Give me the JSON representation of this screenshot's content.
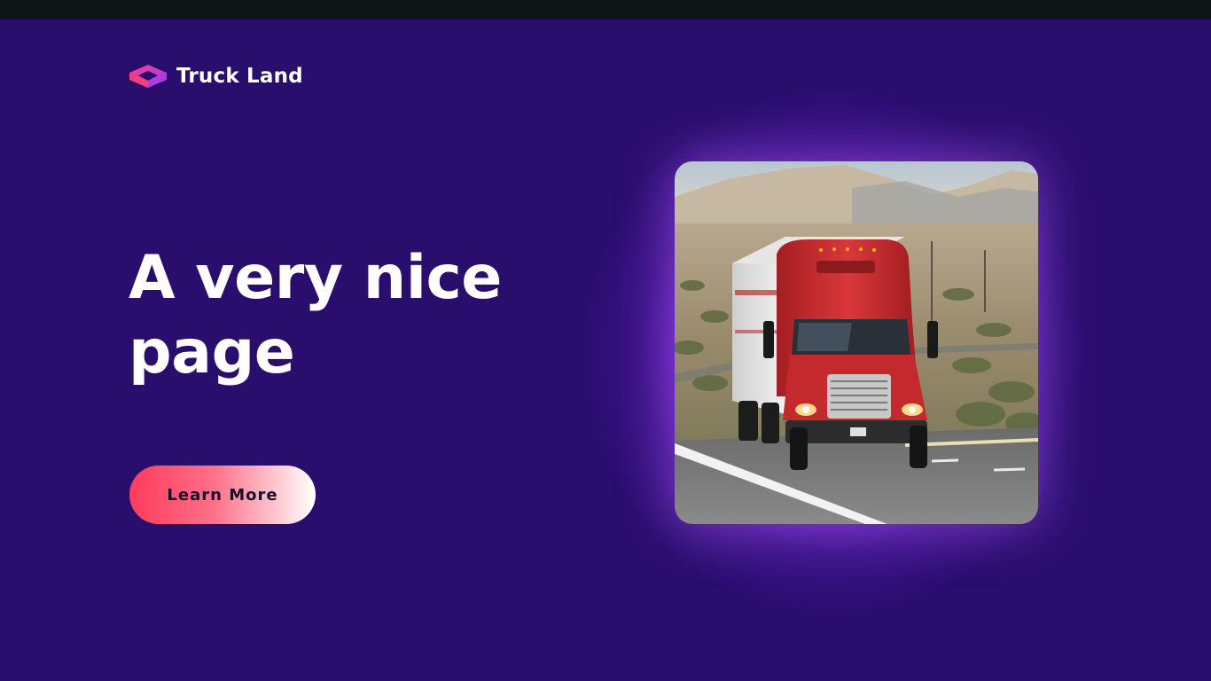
{
  "brand": {
    "name": "Truck Land",
    "logo_icon": "hexagon-logo-icon"
  },
  "hero": {
    "title": "A very nice page",
    "cta_label": "Learn More",
    "image_icon": "truck-photo"
  },
  "colors": {
    "background": "#2a0e6e",
    "topbar": "#0f1418",
    "cta_start": "#ff3b5c",
    "cta_end": "#ffffff",
    "glow": "#a850ff",
    "logo_pink": "#ff3d8b",
    "logo_purple": "#8b3dff"
  }
}
